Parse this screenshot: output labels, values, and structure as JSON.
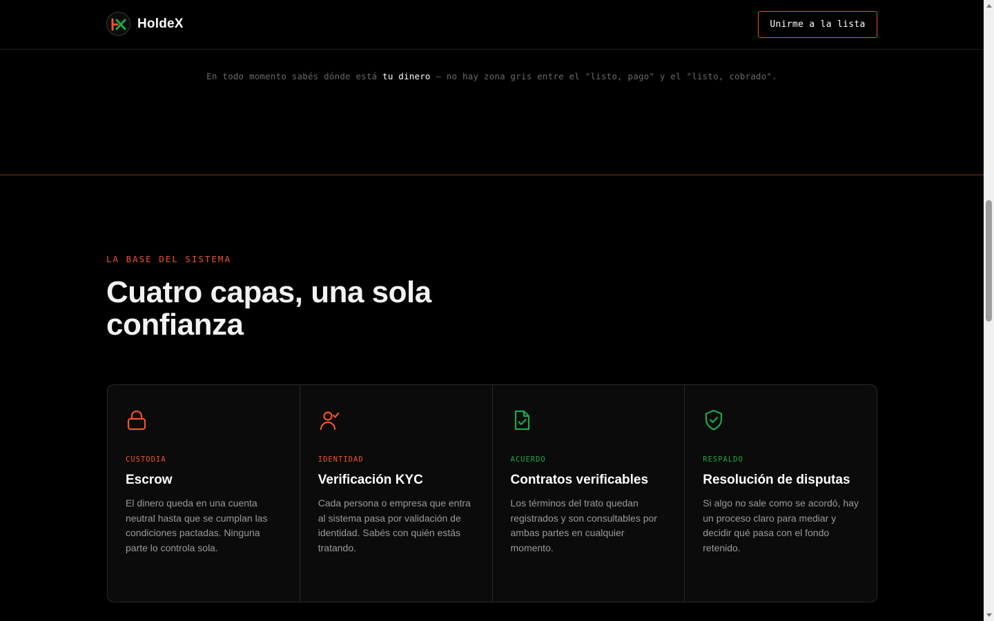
{
  "header": {
    "brand_name": "HoldeX",
    "cta_label": "Unirme a la lista"
  },
  "tagline": {
    "before": "En todo momento sabés dónde está ",
    "highlight": "tu dinero",
    "after": " — no hay zona gris entre el \"listo, pago\" y el \"listo, cobrado\"."
  },
  "section": {
    "eyebrow": "LA BASE DEL SISTEMA",
    "title_line1": "Cuatro capas, una sola",
    "title_line2": "confianza"
  },
  "cards": [
    {
      "icon": "lock-icon",
      "tag": "CUSTODIA",
      "title": "Escrow",
      "description": "El dinero queda en una cuenta neutral hasta que se cumplan las condiciones pactadas. Ninguna parte lo controla sola.",
      "accent": "#f0552a"
    },
    {
      "icon": "user-check-icon",
      "tag": "IDENTIDAD",
      "title": "Verificación KYC",
      "description": "Cada persona o empresa que entra al sistema pasa por validación de identidad. Sabés con quién estás tratando.",
      "accent": "#f0552a"
    },
    {
      "icon": "document-check-icon",
      "tag": "ACUERDO",
      "title": "Contratos verificables",
      "description": "Los términos del trato quedan registrados y son consultables por ambas partes en cualquier momento.",
      "accent": "#1fa84a"
    },
    {
      "icon": "shield-check-icon",
      "tag": "RESPALDO",
      "title": "Resolución de disputas",
      "description": "Si algo no sale como se acordó, hay un proceso claro para mediar y decidir qué pasa con el fondo retenido.",
      "accent": "#1fa84a"
    }
  ],
  "colors": {
    "orange": "#f0552a",
    "green": "#1fa84a",
    "background": "#000000"
  }
}
